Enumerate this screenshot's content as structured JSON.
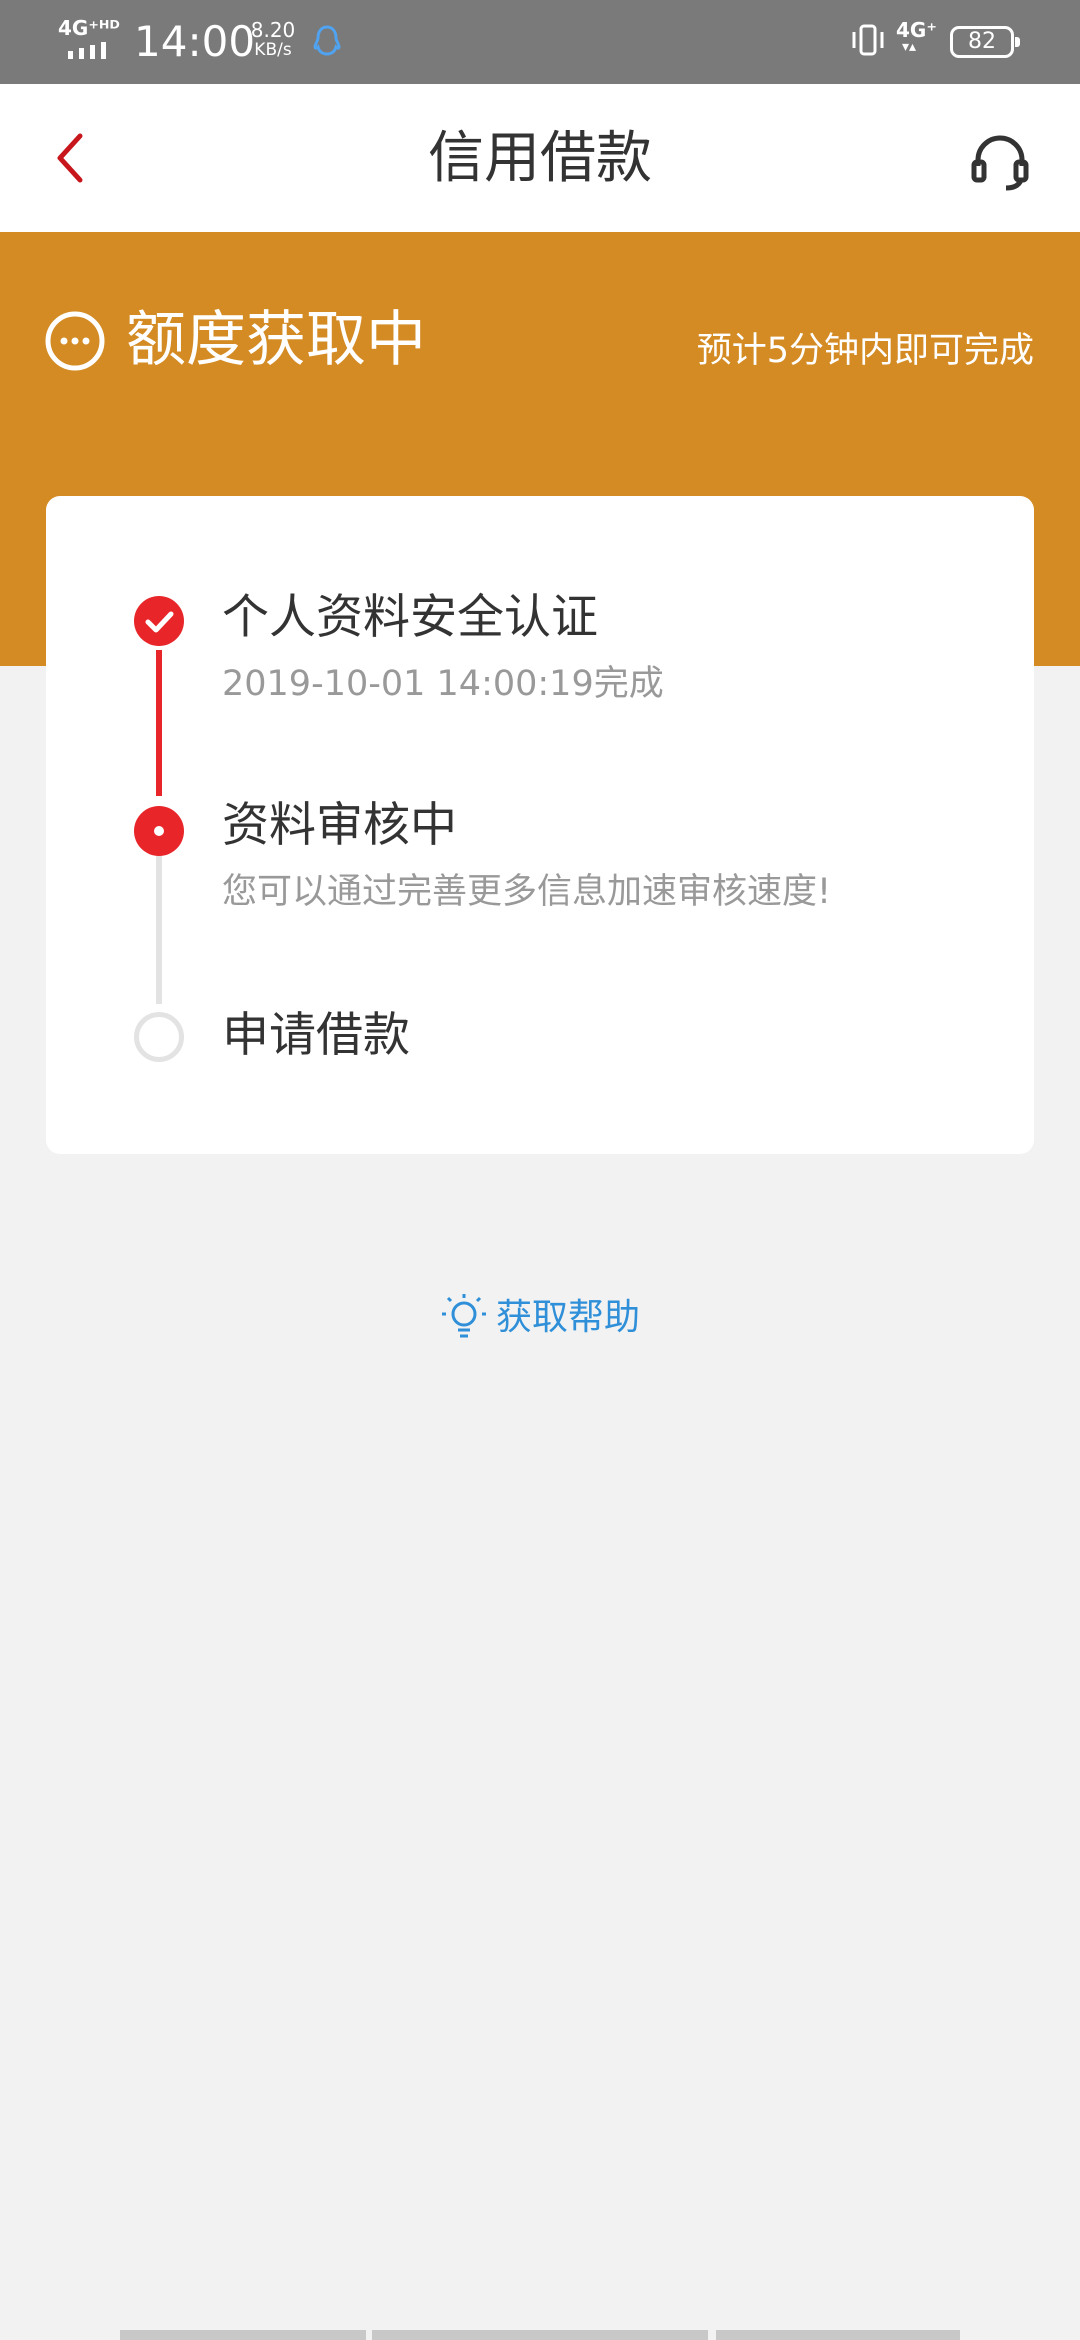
{
  "status_bar": {
    "network_left": "4G⁺ᴴᴰ",
    "time": "14:00",
    "speed_value": "8.20",
    "speed_unit": "KB/s",
    "network_right": "4G⁺",
    "battery": "82"
  },
  "header": {
    "title": "信用借款",
    "back_icon": "chevron-left-icon",
    "service_icon": "headset-icon"
  },
  "banner": {
    "status_icon": "more-circle-icon",
    "title": "额度获取中",
    "hint": "预计5分钟内即可完成",
    "color": "#d48b23"
  },
  "steps": [
    {
      "title": "个人资料安全认证",
      "subtitle": "2019-10-01 14:00:19完成",
      "state": "done"
    },
    {
      "title": "资料审核中",
      "subtitle": "您可以通过完善更多信息加速审核速度!",
      "state": "active"
    },
    {
      "title": "申请借款",
      "subtitle": "",
      "state": "pending"
    }
  ],
  "help": {
    "icon": "lightbulb-icon",
    "label": "获取帮助",
    "color": "#2f8fd8"
  },
  "colors": {
    "accent_red": "#e8262a",
    "pending_grey": "#e3e3e3"
  }
}
